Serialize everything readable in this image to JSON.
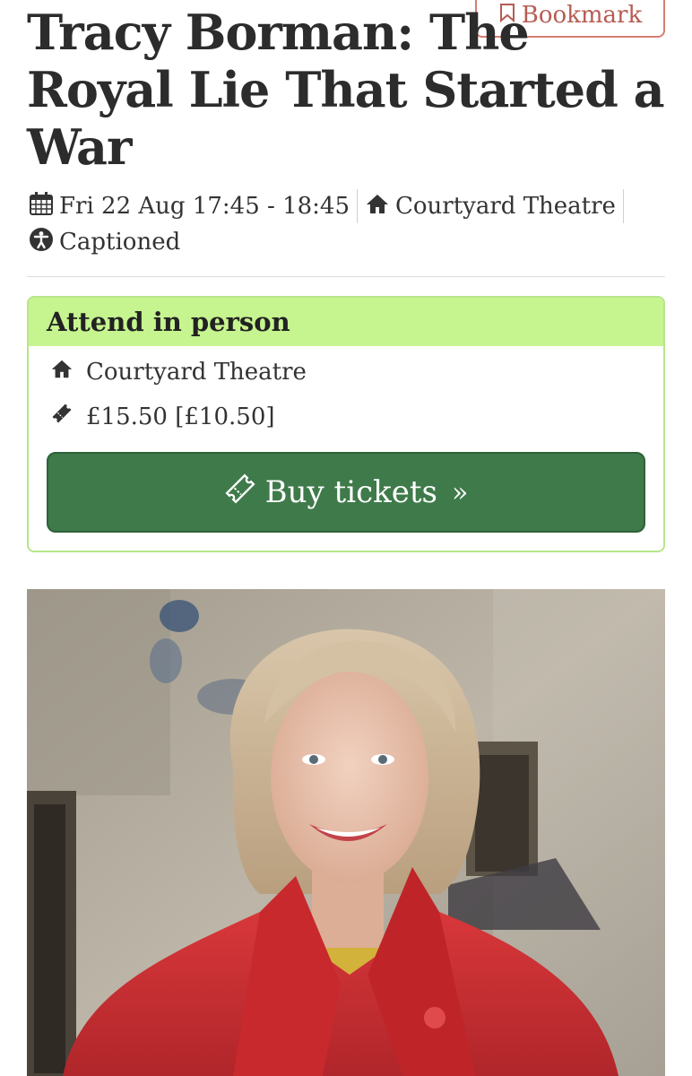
{
  "event": {
    "title": "Tracy Borman: The Royal Lie That Started a War",
    "date_time": "Fri 22 Aug 17:45 - 18:45",
    "venue": "Courtyard Theatre",
    "access": "Captioned"
  },
  "bookmark": {
    "label": "Bookmark",
    "icon": "bookmark-icon"
  },
  "attend": {
    "heading": "Attend in person",
    "venue": "Courtyard Theatre",
    "price": "£15.50 [£10.50]",
    "buy_label": "Buy tickets",
    "buy_chevron": "»"
  },
  "colors": {
    "bookmark_border": "#d77d72",
    "attend_header_bg": "#c6f48f",
    "attend_border": "#b8e58a",
    "buy_button_bg": "#3f7a4a"
  }
}
